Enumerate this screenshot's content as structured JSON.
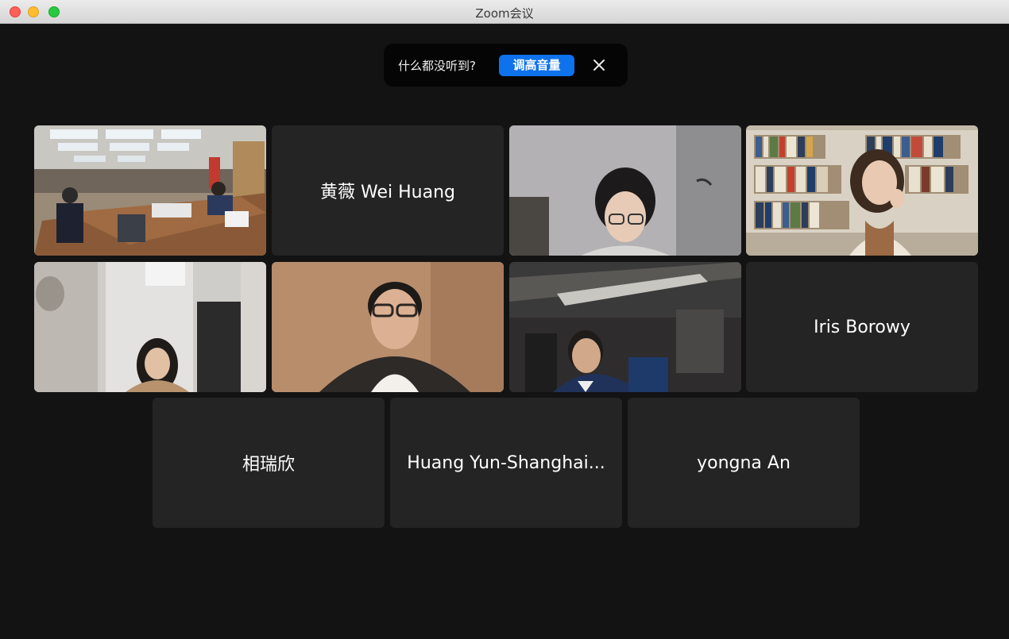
{
  "window": {
    "title": "Zoom会议"
  },
  "banner": {
    "message": "什么都没听到?",
    "action_label": "调高音量",
    "accent": "#0e72ed"
  },
  "gallery": {
    "active_speaker_color": "#23d959",
    "participants": [
      {
        "name": "",
        "video": true,
        "active": true,
        "scene": "conference-room"
      },
      {
        "name": "黄薇 Wei Huang",
        "video": false
      },
      {
        "name": "",
        "video": true,
        "scene": "woman-glasses"
      },
      {
        "name": "",
        "video": true,
        "scene": "woman-bookshelf"
      },
      {
        "name": "",
        "video": true,
        "scene": "woman-blurred-room"
      },
      {
        "name": "",
        "video": true,
        "scene": "man-glasses-vest"
      },
      {
        "name": "",
        "video": true,
        "scene": "man-suit"
      },
      {
        "name": "Iris Borowy",
        "video": false
      },
      {
        "name": "相瑞欣",
        "video": false
      },
      {
        "name": "Huang Yun-Shanghai...",
        "video": false
      },
      {
        "name": "yongna An",
        "video": false
      }
    ]
  }
}
